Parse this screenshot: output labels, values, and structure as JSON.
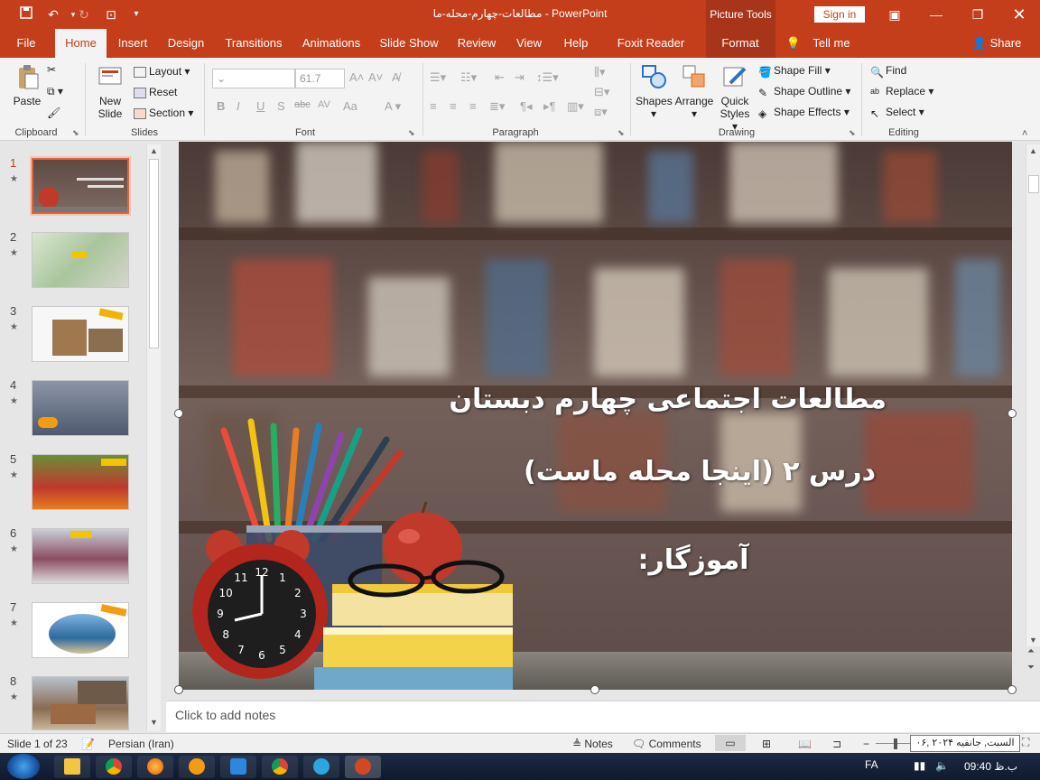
{
  "app": {
    "title": "مطالعات-چهارم-محله-ما  -  PowerPoint",
    "context_tab_group": "Picture Tools",
    "sign_in": "Sign in"
  },
  "tabs": [
    {
      "label": "File"
    },
    {
      "label": "Home"
    },
    {
      "label": "Insert"
    },
    {
      "label": "Design"
    },
    {
      "label": "Transitions"
    },
    {
      "label": "Animations"
    },
    {
      "label": "Slide Show"
    },
    {
      "label": "Review"
    },
    {
      "label": "View"
    },
    {
      "label": "Help"
    },
    {
      "label": "Foxit Reader PDF"
    },
    {
      "label": "Format"
    },
    {
      "label": "Tell me"
    },
    {
      "label": "Share"
    }
  ],
  "ribbon": {
    "clipboard": {
      "paste": "Paste",
      "label": "Clipboard"
    },
    "slides": {
      "new_slide_1": "New",
      "new_slide_2": "Slide",
      "layout": "Layout",
      "reset": "Reset",
      "section": "Section",
      "label": "Slides"
    },
    "font": {
      "size": "61.7",
      "label": "Font"
    },
    "paragraph": {
      "label": "Paragraph"
    },
    "drawing": {
      "shapes": "Shapes",
      "arrange": "Arrange",
      "quick_1": "Quick",
      "quick_2": "Styles",
      "shape_fill": "Shape Fill",
      "shape_outline": "Shape Outline",
      "shape_effects": "Shape Effects",
      "label": "Drawing"
    },
    "editing": {
      "find": "Find",
      "replace": "Replace",
      "select": "Select",
      "label": "Editing"
    }
  },
  "thumbnails": [
    {
      "num": "1"
    },
    {
      "num": "2"
    },
    {
      "num": "3"
    },
    {
      "num": "4"
    },
    {
      "num": "5"
    },
    {
      "num": "6"
    },
    {
      "num": "7"
    },
    {
      "num": "8"
    }
  ],
  "slide": {
    "line1": "مطالعات اجتماعی چهارم دبستان",
    "line2": "درس ۲ (اینجا محله ماست)",
    "line3": "آموزگار:",
    "clock": [
      "12",
      "1",
      "2",
      "3",
      "4",
      "5",
      "6",
      "7",
      "8",
      "9",
      "10",
      "11"
    ]
  },
  "notes": {
    "placeholder": "Click to add notes"
  },
  "status": {
    "slide_of": "Slide 1 of 23",
    "language": "Persian (Iran)",
    "notes": "Notes",
    "comments": "Comments"
  },
  "taskbar": {
    "lang": "FA",
    "time": "09:40 ب.ظ",
    "date_tooltip": "السبت, جانفیه ۲۰۲۴ ,۰۶"
  },
  "colors": {
    "accent": "#c43e1c",
    "ribbon_bg": "#f3f3f3",
    "panel_bg": "#e6e6e6"
  }
}
